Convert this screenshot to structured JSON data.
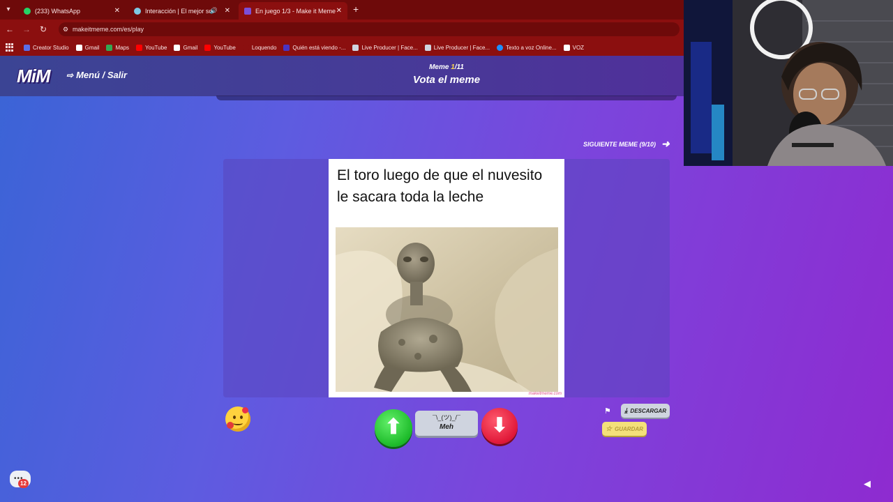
{
  "browser": {
    "tabs": [
      {
        "title": "(233) WhatsApp",
        "favicon_color": "#25d366"
      },
      {
        "title": "Interacción | El mejor softw...",
        "favicon_color": "#7ec8e3"
      },
      {
        "title": "En juego 1/3 - Make it Meme",
        "favicon_color": "#7b4fd8"
      }
    ],
    "url": "makeitmeme.com/es/play",
    "bookmarks": [
      {
        "label": "Creator Studio",
        "color": "#5b6ee8"
      },
      {
        "label": "Gmail",
        "color": "#ffffff"
      },
      {
        "label": "Maps",
        "color": "#34a853"
      },
      {
        "label": "YouTube",
        "color": "#ff0000"
      },
      {
        "label": "Gmail",
        "color": "#ffffff"
      },
      {
        "label": "YouTube",
        "color": "#ff0000"
      },
      {
        "label": "Loquendo",
        "color": "#8b0f0f"
      },
      {
        "label": "Quién está viendo -...",
        "color": "#4a34c2"
      },
      {
        "label": "Live Producer | Face...",
        "color": "#cfd4df"
      },
      {
        "label": "Live Producer | Face...",
        "color": "#cfd4df"
      },
      {
        "label": "Texto a voz Online...",
        "color": "#1e90ff"
      },
      {
        "label": "VOZ",
        "color": "#ffffff"
      }
    ]
  },
  "game": {
    "logo": "MiM",
    "menu_exit": "Menú / Salir",
    "round_label": "Meme",
    "round_current": "1",
    "round_total": "/11",
    "phase_title": "Vota el meme",
    "next_button": "SIGUIENTE MEME (9/10)",
    "meme": {
      "caption": "El toro luego de que el nuvesito le sacara toda la leche",
      "watermark": "makeitmeme.com"
    },
    "vote": {
      "meh_shrug": "¯\\_(ツ)_/¯",
      "meh_label": "Meh"
    },
    "download_label": "DESCARGAR",
    "save_label": "GUARDAR",
    "chat_badge": "12"
  },
  "colors": {
    "accent_purple": "#7b45dc",
    "upvote": "#1dbb2a",
    "downvote": "#e01838",
    "browser_chrome": "#8b0f0f"
  }
}
